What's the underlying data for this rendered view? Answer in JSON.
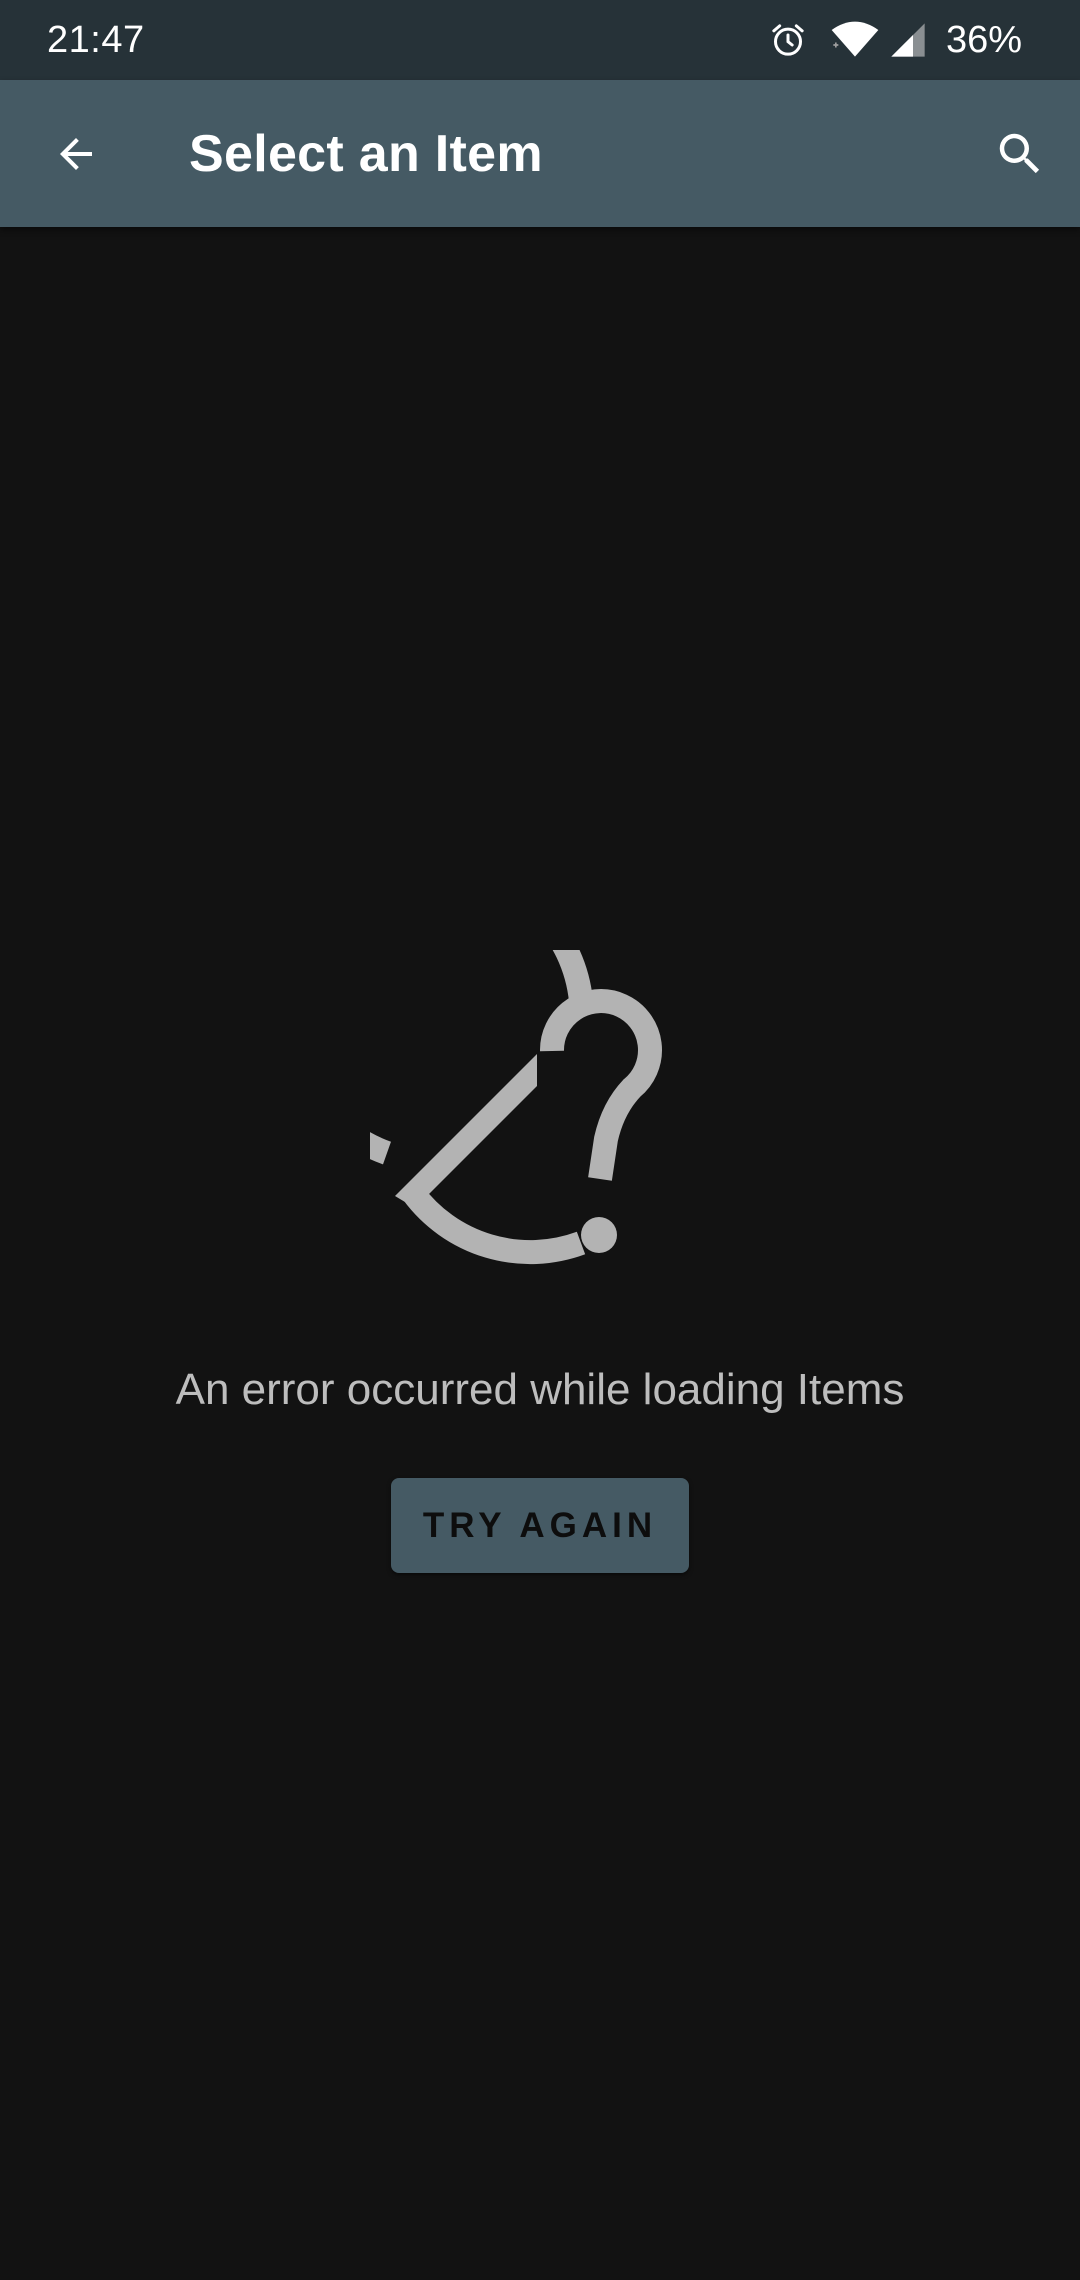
{
  "status_bar": {
    "time": "21:47",
    "battery": "36%",
    "icons": [
      "alarm-icon",
      "wifi-icon",
      "cellular-signal-icon"
    ]
  },
  "app_bar": {
    "title": "Select an Item",
    "back_icon": "arrow-back-icon",
    "search_icon": "search-icon",
    "background_color": "#455a64"
  },
  "error_state": {
    "icon": "error-question-icon",
    "message": "An error occurred while loading Items",
    "retry_label": "TRY AGAIN"
  },
  "colors": {
    "status_bar": "#263238",
    "background": "#121212",
    "accent": "#455a64",
    "muted_text": "#bdbdbd"
  }
}
